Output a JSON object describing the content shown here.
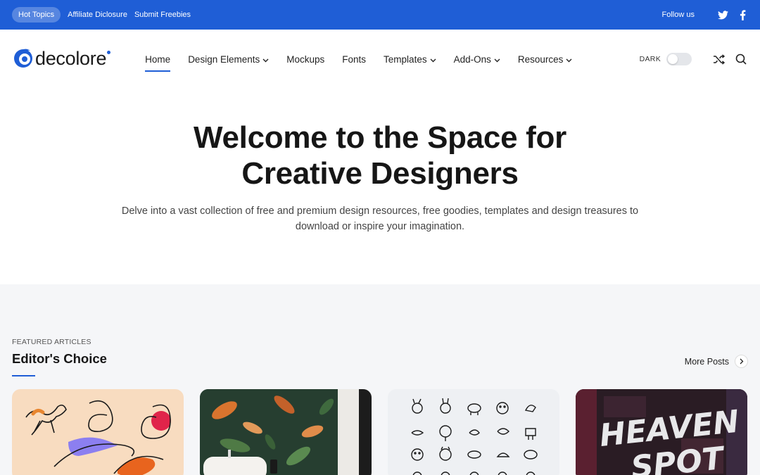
{
  "topbar": {
    "hot_topics": "Hot Topics",
    "links": [
      "Affiliate Diclosure",
      "Submit Freebies"
    ],
    "follow_label": "Follow us",
    "social_icons": [
      "twitter-icon",
      "facebook-icon"
    ]
  },
  "header": {
    "logo_text": "decolore",
    "nav": [
      {
        "label": "Home",
        "active": true,
        "dropdown": false
      },
      {
        "label": "Design Elements",
        "active": false,
        "dropdown": true
      },
      {
        "label": "Mockups",
        "active": false,
        "dropdown": false
      },
      {
        "label": "Fonts",
        "active": false,
        "dropdown": false
      },
      {
        "label": "Templates",
        "active": false,
        "dropdown": true
      },
      {
        "label": "Add-Ons",
        "active": false,
        "dropdown": true
      },
      {
        "label": "Resources",
        "active": false,
        "dropdown": true
      }
    ],
    "dark_label": "DARK",
    "dark_mode_on": false,
    "icons": [
      "shuffle-icon",
      "search-icon"
    ]
  },
  "hero": {
    "title_line1": "Welcome to the Space for",
    "title_line2": "Creative Designers",
    "subtitle": "Delve into a vast collection of free and premium design resources, free goodies, templates and design treasures to download or inspire your imagination."
  },
  "featured": {
    "kicker": "FEATURED ARTICLES",
    "title": "Editor's Choice",
    "more_label": "More Posts",
    "cards": [
      {
        "name": "card-line-art-animals",
        "tag_color": "#1f5ed6"
      },
      {
        "name": "card-botanical-wallpaper",
        "tag_color": "#e05a5a"
      },
      {
        "name": "card-animal-icons",
        "tag_color": "#f2a03d"
      },
      {
        "name": "card-heaven-spot-font",
        "tag_color": "#f2a03d"
      }
    ]
  },
  "colors": {
    "brand": "#1f5ed6",
    "text": "#161616",
    "section_bg": "#f5f6f8"
  }
}
